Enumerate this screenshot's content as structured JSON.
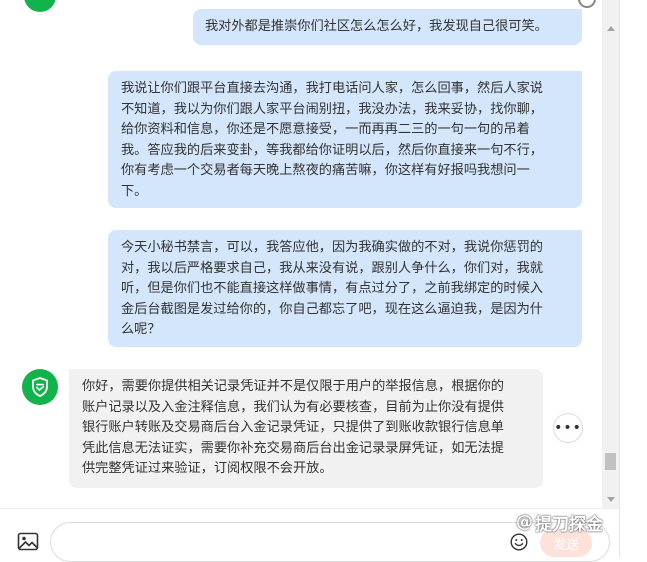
{
  "messages": [
    {
      "role": "user",
      "text": "我对外都是推崇你们社区怎么怎么好，我发现自己很可笑。"
    },
    {
      "role": "user",
      "text": "我说让你们跟平台直接去沟通，我打电话问人家，怎么回事，然后人家说\n不知道，我以为你们跟人家平台闹别扭，我没办法，我来妥协，找你聊，\n给你资料和信息，你还是不愿意接受，一而再再二三的一句一句的吊着\n我。答应我的后来变卦，等我都给你证明以后，然后你直接来一句不行，\n你有考虑一个交易者每天晚上熬夜的痛苦嘛，你这样有好报吗我想问一\n下。"
    },
    {
      "role": "user",
      "text": "今天小秘书禁言，可以，我答应他，因为我确实做的不对，我说你惩罚的\n对，我以后严格要求自己，我从来没有说，跟别人争什么，你们对，我就\n听，但是你们也不能直接这样做事情，有点过分了，之前我绑定的时候入\n金后台截图是发过给你的，你自己都忘了吧，现在这么逼迫我，是因为什\n么呢？"
    },
    {
      "role": "bot",
      "text": "你好，需要你提供相关记录凭证并不是仅限于用户的举报信息，根据你的\n账户记录以及入金注释信息，我们认为有必要核查，目前为止你没有提供\n银行账户转账及交易商后台入金记录凭证，只提供了到账收款银行信息单\n凭此信息无法证实，需要你补充交易商后台出金记录录屏凭证，如无法提\n供完整凭证过来验证，订阅权限不会开放。"
    }
  ],
  "more_label": "•••",
  "input": {
    "value": "",
    "placeholder": ""
  },
  "send_label": "发送",
  "watermark": {
    "prefix": "@",
    "text": "提刀探金"
  },
  "colors": {
    "user_bubble": "#d3e6fb",
    "bot_bubble": "#f1f1f1",
    "avatar": "#12b34a",
    "send_button": "#fde2dc"
  },
  "icons": [
    "shield-check-icon",
    "more-icon",
    "image-icon",
    "emoji-icon",
    "scroll-up-arrow-icon",
    "scroll-down-arrow-icon"
  ]
}
